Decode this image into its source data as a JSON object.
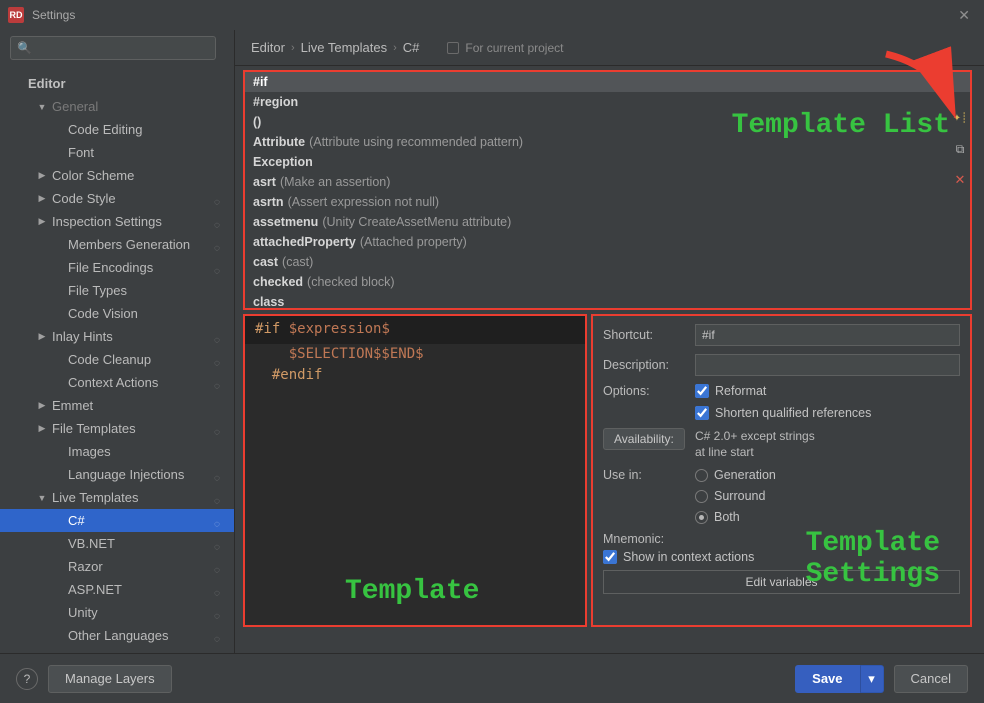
{
  "titlebar": {
    "title": "Settings",
    "app_badge": "RD"
  },
  "search": {
    "placeholder": ""
  },
  "tree": {
    "heading": "Editor",
    "items": [
      {
        "label": "General",
        "depth": 1,
        "arrow": "down",
        "truncated": true
      },
      {
        "label": "Code Editing",
        "depth": 2
      },
      {
        "label": "Font",
        "depth": 2
      },
      {
        "label": "Color Scheme",
        "depth": 1,
        "arrow": "right"
      },
      {
        "label": "Code Style",
        "depth": 1,
        "arrow": "right",
        "badge": true
      },
      {
        "label": "Inspection Settings",
        "depth": 1,
        "arrow": "right",
        "badge": true
      },
      {
        "label": "Members Generation",
        "depth": 2,
        "badge": true
      },
      {
        "label": "File Encodings",
        "depth": 2,
        "badge": true
      },
      {
        "label": "File Types",
        "depth": 2
      },
      {
        "label": "Code Vision",
        "depth": 2
      },
      {
        "label": "Inlay Hints",
        "depth": 1,
        "arrow": "right",
        "badge": true
      },
      {
        "label": "Code Cleanup",
        "depth": 2,
        "badge": true
      },
      {
        "label": "Context Actions",
        "depth": 2,
        "badge": true
      },
      {
        "label": "Emmet",
        "depth": 1,
        "arrow": "right"
      },
      {
        "label": "File Templates",
        "depth": 1,
        "arrow": "right",
        "badge": true
      },
      {
        "label": "Images",
        "depth": 2
      },
      {
        "label": "Language Injections",
        "depth": 2,
        "badge": true
      },
      {
        "label": "Live Templates",
        "depth": 1,
        "arrow": "down",
        "badge": true
      },
      {
        "label": "C#",
        "depth": 2,
        "selected": true,
        "badge": true
      },
      {
        "label": "VB.NET",
        "depth": 2,
        "badge": true
      },
      {
        "label": "Razor",
        "depth": 2,
        "badge": true
      },
      {
        "label": "ASP.NET",
        "depth": 2,
        "badge": true
      },
      {
        "label": "Unity",
        "depth": 2,
        "badge": true
      },
      {
        "label": "Other Languages",
        "depth": 2,
        "badge": true
      }
    ]
  },
  "breadcrumb": {
    "a": "Editor",
    "b": "Live Templates",
    "c": "C#"
  },
  "project_toggle": "For current project",
  "templates": [
    {
      "key": "#if",
      "selected": true
    },
    {
      "key": "#region"
    },
    {
      "key": "()"
    },
    {
      "key": "Attribute",
      "desc": "(Attribute using recommended pattern)"
    },
    {
      "key": "Exception"
    },
    {
      "key": "asrt",
      "desc": "(Make an assertion)"
    },
    {
      "key": "asrtn",
      "desc": "(Assert expression not null)"
    },
    {
      "key": "assetmenu",
      "desc": "(Unity CreateAssetMenu attribute)"
    },
    {
      "key": "attachedProperty",
      "desc": "(Attached property)"
    },
    {
      "key": "cast",
      "desc": "(cast)"
    },
    {
      "key": "checked",
      "desc": "(checked block)"
    },
    {
      "key": "class"
    }
  ],
  "editor": {
    "l1a": "#if",
    "l1b": "$expression$",
    "l2a": "$SELECTION$$END$",
    "l3a": "#endif"
  },
  "settings": {
    "shortcut_label": "Shortcut:",
    "shortcut_value": "#if",
    "description_label": "Description:",
    "description_value": "",
    "options_label": "Options:",
    "reformat": "Reformat",
    "shorten": "Shorten qualified references",
    "availability_button": "Availability:",
    "availability_text1": "C# 2.0+ except strings",
    "availability_text2": "at line start",
    "use_in_label": "Use in:",
    "use_generation": "Generation",
    "use_surround": "Surround",
    "use_both": "Both",
    "mnemonic_label": "Mnemonic:",
    "show_ca": "Show in context actions",
    "edit_vars": "Edit variables"
  },
  "annotations": {
    "list": "Template List",
    "code": "Template",
    "settings": "Template\nSettings"
  },
  "footer": {
    "manage": "Manage Layers",
    "save": "Save",
    "cancel": "Cancel"
  }
}
